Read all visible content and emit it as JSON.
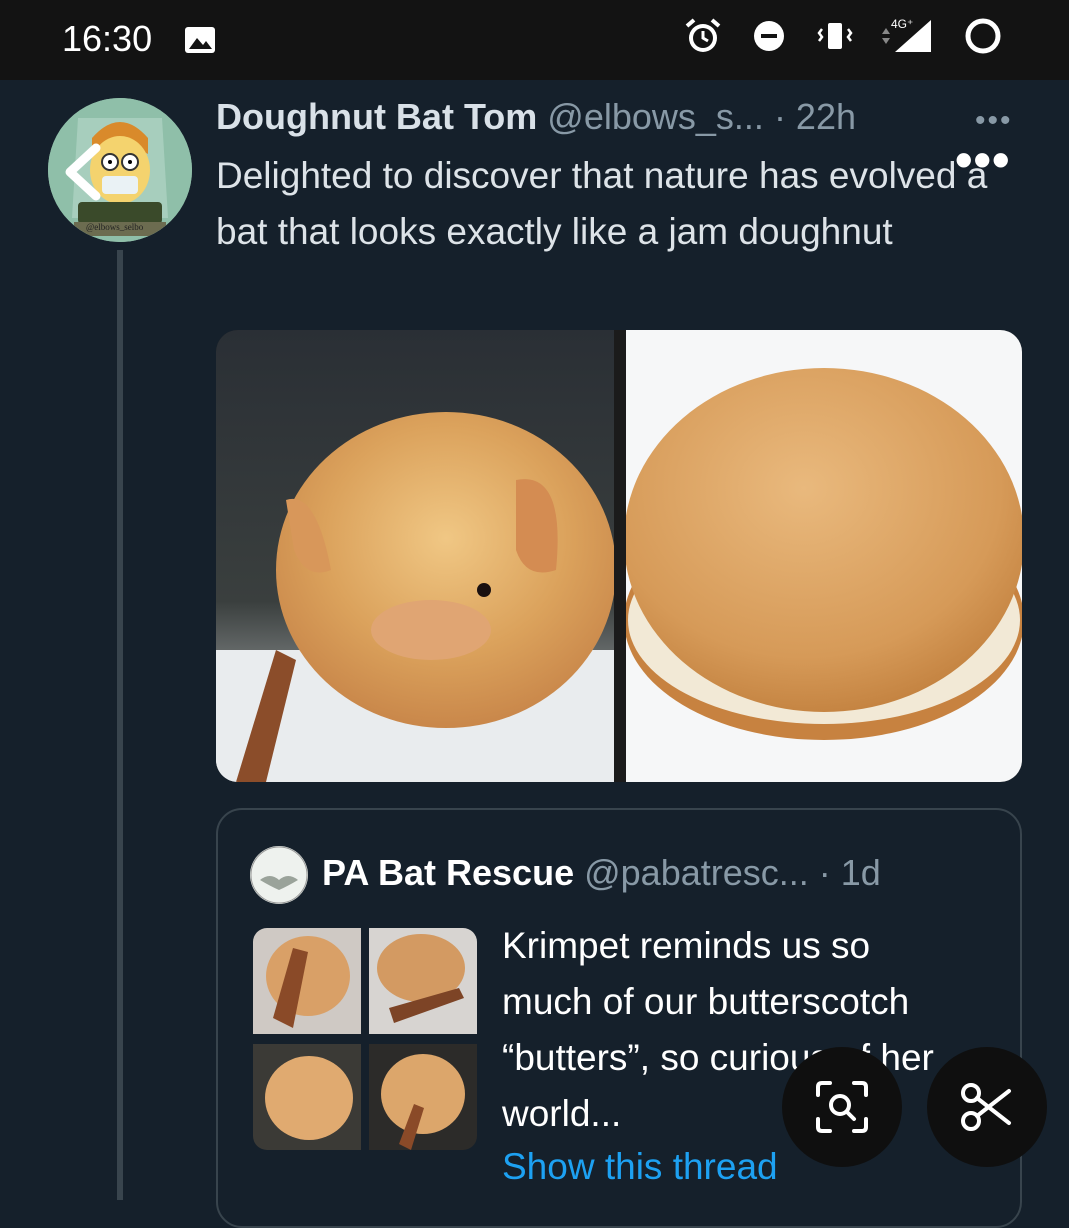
{
  "status_bar": {
    "time": "16:30",
    "icons": [
      "gallery-icon",
      "alarm-icon",
      "dnd-icon",
      "vibrate-icon",
      "signal-icon",
      "battery-icon"
    ],
    "network": "4G⁺"
  },
  "tweet": {
    "display_name": "Doughnut Bat Tom",
    "handle": "@elbows_s...",
    "time": "· 22h",
    "more_small": "•••",
    "more_big": "•••",
    "text": "Delighted to discover that nature has evolved a bat that looks exactly like a jam doughnut",
    "avatar_caption": "@elbows_selbo",
    "media": [
      "bat photo",
      "jam doughnut photo"
    ]
  },
  "quoted_tweet": {
    "display_name": "PA Bat Rescue",
    "handle": "@pabatresc...",
    "time": "· 1d",
    "text": "Krimpet reminds us so much of our butterscotch “butters”, so curious of her world...",
    "show_thread": "Show this thread"
  },
  "overlay": {
    "lens_button": "lens-icon",
    "cut_button": "scissors-icon"
  },
  "colors": {
    "background": "#15202b",
    "link": "#1da1f2",
    "secondary_text": "#8899a6",
    "border": "#38444d"
  }
}
